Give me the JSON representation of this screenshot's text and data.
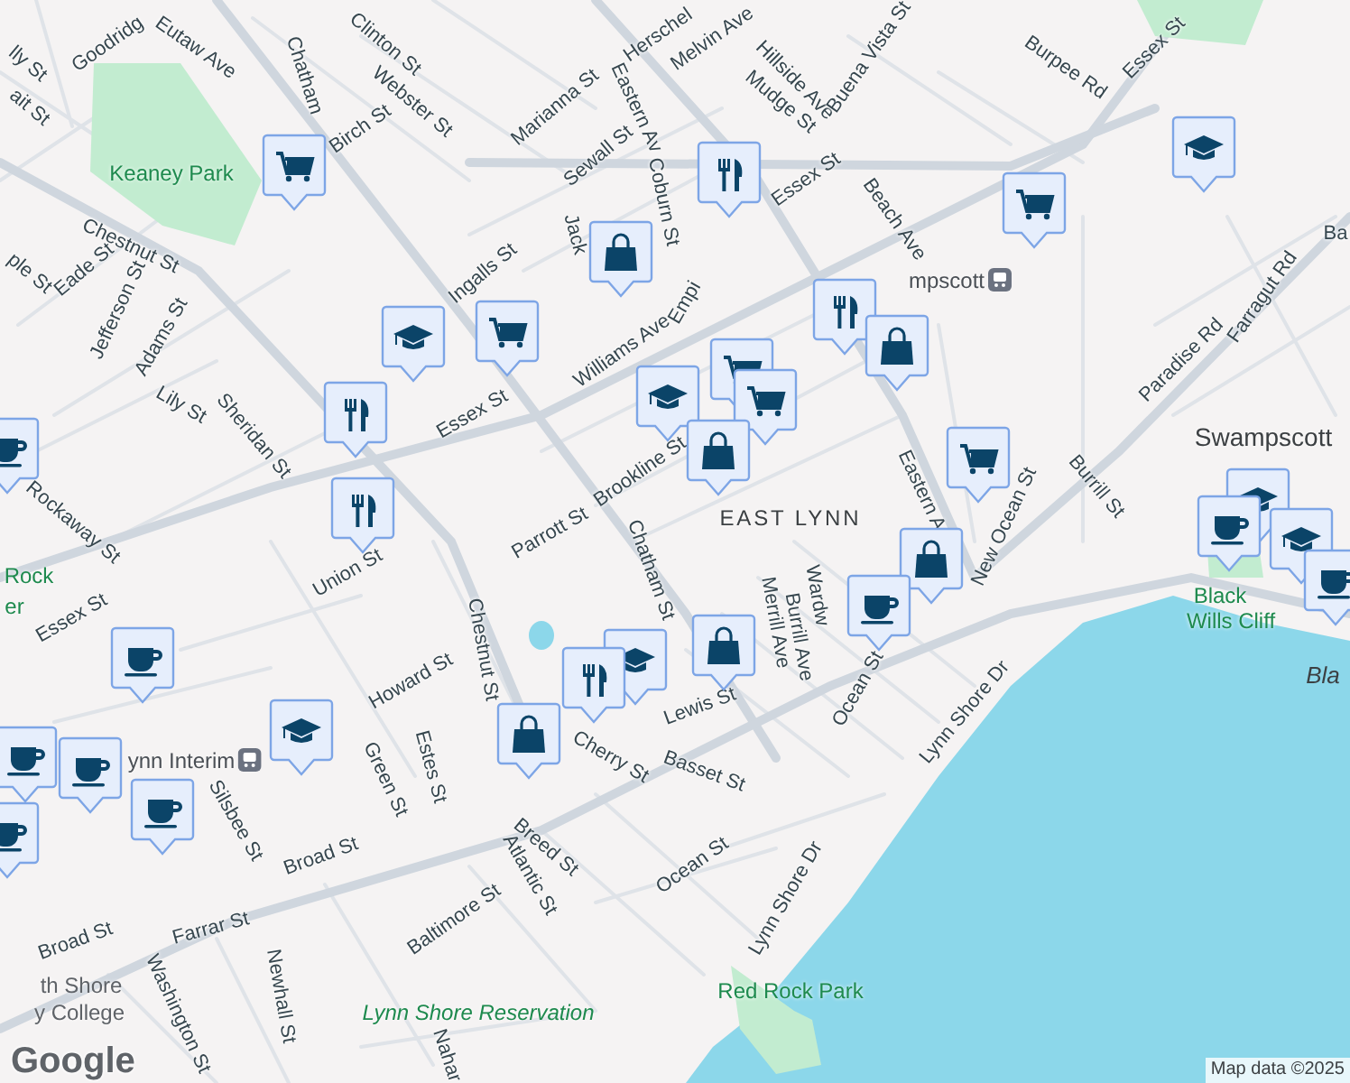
{
  "map": {
    "labels": [
      {
        "text": "Goodridg",
        "kind": "street"
      },
      {
        "text": "Eutaw Ave",
        "kind": "street"
      },
      {
        "text": "Clinton St",
        "kind": "street"
      },
      {
        "text": "Chatham",
        "kind": "street"
      },
      {
        "text": "Webster St",
        "kind": "street"
      },
      {
        "text": "Birch St",
        "kind": "street"
      },
      {
        "text": "Marianna St",
        "kind": "street"
      },
      {
        "text": "Sewall St",
        "kind": "street"
      },
      {
        "text": "Coburn St",
        "kind": "street"
      },
      {
        "text": "Herschel",
        "kind": "street"
      },
      {
        "text": "Eastern Av",
        "kind": "street"
      },
      {
        "text": "Melvin Ave",
        "kind": "street"
      },
      {
        "text": "Hillside Ave",
        "kind": "street"
      },
      {
        "text": "Buena Vista St",
        "kind": "street"
      },
      {
        "text": "Burpee Rd",
        "kind": "street"
      },
      {
        "text": "Essex St",
        "kind": "street"
      },
      {
        "text": "Mudge St",
        "kind": "street"
      },
      {
        "text": "Essex St",
        "kind": "street"
      },
      {
        "text": "Beach Ave",
        "kind": "street"
      },
      {
        "text": "mpscott",
        "kind": "station"
      },
      {
        "text": "Paradise Rd",
        "kind": "street"
      },
      {
        "text": "Farragut Rd",
        "kind": "street"
      },
      {
        "text": "Swampscott",
        "kind": "city"
      },
      {
        "text": "Burrill St",
        "kind": "street"
      },
      {
        "text": "New Ocean St",
        "kind": "street"
      },
      {
        "text": "Eastern A",
        "kind": "street"
      },
      {
        "text": "EAST LYNN",
        "kind": "area"
      },
      {
        "text": "Keaney Park",
        "kind": "park"
      },
      {
        "text": "Chestnut St",
        "kind": "street"
      },
      {
        "text": "Eade St",
        "kind": "street"
      },
      {
        "text": "Jefferson St",
        "kind": "street"
      },
      {
        "text": "Adams St",
        "kind": "street"
      },
      {
        "text": "Lily St",
        "kind": "street"
      },
      {
        "text": "Sheridan St",
        "kind": "street"
      },
      {
        "text": "Ingalls St",
        "kind": "street"
      },
      {
        "text": "Williams Ave",
        "kind": "street"
      },
      {
        "text": "Essex St",
        "kind": "street"
      },
      {
        "text": "Brookline St",
        "kind": "street"
      },
      {
        "text": "Parrott St",
        "kind": "street"
      },
      {
        "text": "Union St",
        "kind": "street"
      },
      {
        "text": "Essex St",
        "kind": "street"
      },
      {
        "text": "Rockaway St",
        "kind": "street"
      },
      {
        "text": "Chatham St",
        "kind": "street"
      },
      {
        "text": "Howard St",
        "kind": "street"
      },
      {
        "text": "Chestnut St",
        "kind": "street"
      },
      {
        "text": "ynn Interim",
        "kind": "station"
      },
      {
        "text": "Green St",
        "kind": "street"
      },
      {
        "text": "Estes St",
        "kind": "street"
      },
      {
        "text": "Silsbee St",
        "kind": "street"
      },
      {
        "text": "Lewis St",
        "kind": "street"
      },
      {
        "text": "Cherry St",
        "kind": "street"
      },
      {
        "text": "Basset St",
        "kind": "street"
      },
      {
        "text": "Breed St",
        "kind": "street"
      },
      {
        "text": "Atlantic St",
        "kind": "street"
      },
      {
        "text": "Broad St",
        "kind": "street"
      },
      {
        "text": "Broad St",
        "kind": "street"
      },
      {
        "text": "Baltimore St",
        "kind": "street"
      },
      {
        "text": "Ocean St",
        "kind": "street"
      },
      {
        "text": "Ocean St",
        "kind": "street"
      },
      {
        "text": "Lynn Shore Dr",
        "kind": "street"
      },
      {
        "text": "Lynn Shore Dr",
        "kind": "street"
      },
      {
        "text": "Farrar St",
        "kind": "street"
      },
      {
        "text": "Newhall St",
        "kind": "street"
      },
      {
        "text": "Washington St",
        "kind": "street"
      },
      {
        "text": "Nahar",
        "kind": "street"
      },
      {
        "text": "Lynn Shore Reservation",
        "kind": "reserve"
      },
      {
        "text": "Red Rock Park",
        "kind": "park"
      },
      {
        "text": "Black",
        "kind": "park"
      },
      {
        "text": "Wills Cliff",
        "kind": "park"
      },
      {
        "text": "Bla",
        "kind": "water"
      },
      {
        "text": "Merrill Ave",
        "kind": "street"
      },
      {
        "text": "Burrill Ave",
        "kind": "street"
      },
      {
        "text": "Wardw",
        "kind": "street"
      },
      {
        "text": "Rock",
        "kind": "park"
      },
      {
        "text": "er",
        "kind": "park"
      },
      {
        "text": "th Shore",
        "kind": "college"
      },
      {
        "text": "y College",
        "kind": "college"
      },
      {
        "text": "lly St",
        "kind": "street"
      },
      {
        "text": "ait St",
        "kind": "street"
      },
      {
        "text": "ple St",
        "kind": "street"
      },
      {
        "text": "Jack",
        "kind": "street"
      },
      {
        "text": "Empi",
        "kind": "street"
      },
      {
        "text": "Ba",
        "kind": "street"
      }
    ],
    "pins": [
      {
        "kind": "cart"
      },
      {
        "kind": "food"
      },
      {
        "kind": "shop"
      },
      {
        "kind": "school"
      },
      {
        "kind": "cart"
      },
      {
        "kind": "food"
      },
      {
        "kind": "shop"
      },
      {
        "kind": "school"
      },
      {
        "kind": "cart"
      },
      {
        "kind": "cart"
      },
      {
        "kind": "cart"
      },
      {
        "kind": "school"
      },
      {
        "kind": "shop"
      },
      {
        "kind": "food"
      },
      {
        "kind": "food"
      },
      {
        "kind": "cafe"
      },
      {
        "kind": "cart"
      },
      {
        "kind": "school"
      },
      {
        "kind": "cafe"
      },
      {
        "kind": "school"
      },
      {
        "kind": "cafe"
      },
      {
        "kind": "shop"
      },
      {
        "kind": "cafe"
      },
      {
        "kind": "shop"
      },
      {
        "kind": "school"
      },
      {
        "kind": "food"
      },
      {
        "kind": "shop"
      },
      {
        "kind": "school"
      },
      {
        "kind": "cafe"
      },
      {
        "kind": "cafe"
      },
      {
        "kind": "cafe"
      },
      {
        "kind": "cafe"
      },
      {
        "kind": "cafe"
      }
    ],
    "logo": "Google",
    "attribution": "Map data ©2025"
  }
}
